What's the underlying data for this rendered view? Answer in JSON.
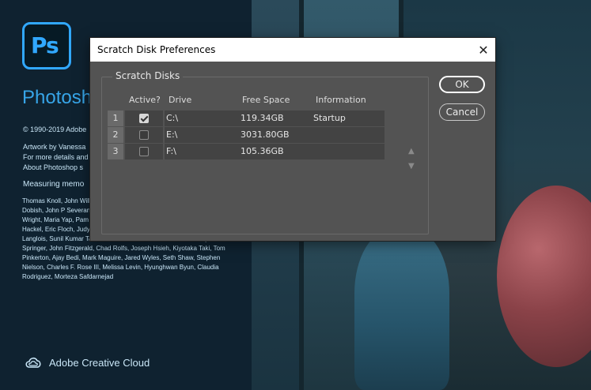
{
  "splash": {
    "logo_text": "Ps",
    "app_name": "Photoshop",
    "copyright": "© 1990-2019 Adobe",
    "artwork_lines": [
      "Artwork by Vanessa",
      "For more details and",
      "About Photoshop s"
    ],
    "measuring": "Measuring memo",
    "credits": "Thomas Knoll, John Williams, Jackie Lincoln, Jerry Harris, Mike Sh David Dobish, John P Severance, Yuko Kag Tai Luxon, Vinod Balakrishnan, Tim Wright, Maria Yap, Pam Clark, Kyoko Itoda, Steve Guilhamet, David Hackel, Eric Floch, Judy Lee, Kevin Hopps, John E. Hanson, Jenee Langlois, Sunil Kumar Tandon, Salil Tambe, Maddie Golison, Vicky Springer, John Fitzgerald, Chad Rolfs, Joseph Hsieh, Kiyotaka Taki, Tom Pinkerton, Ajay Bedi, Mark Maguire, Jared Wyles, Seth Shaw, Stephen Nielson, Charles F. Rose III, Melissa Levin, Hyunghwan Byun, Claudia Rodriguez, Morteza Safdarnejad",
    "creative_cloud": "Adobe Creative Cloud"
  },
  "dialog": {
    "title": "Scratch Disk Preferences",
    "close_glyph": "✕",
    "group_label": "Scratch Disks",
    "columns": {
      "active": "Active?",
      "drive": "Drive",
      "free_space": "Free Space",
      "information": "Information"
    },
    "rows": [
      {
        "num": "1",
        "active": true,
        "drive": "C:\\",
        "free_space": "119.34GB",
        "info": "Startup"
      },
      {
        "num": "2",
        "active": false,
        "drive": "E:\\",
        "free_space": "3031.80GB",
        "info": ""
      },
      {
        "num": "3",
        "active": false,
        "drive": "F:\\",
        "free_space": "105.36GB",
        "info": ""
      }
    ],
    "move_up_glyph": "▲",
    "move_down_glyph": "▼",
    "ok_label": "OK",
    "cancel_label": "Cancel"
  },
  "colors": {
    "accent": "#31a8ff",
    "dialog_bg": "#535353",
    "cell_bg": "#434343"
  }
}
